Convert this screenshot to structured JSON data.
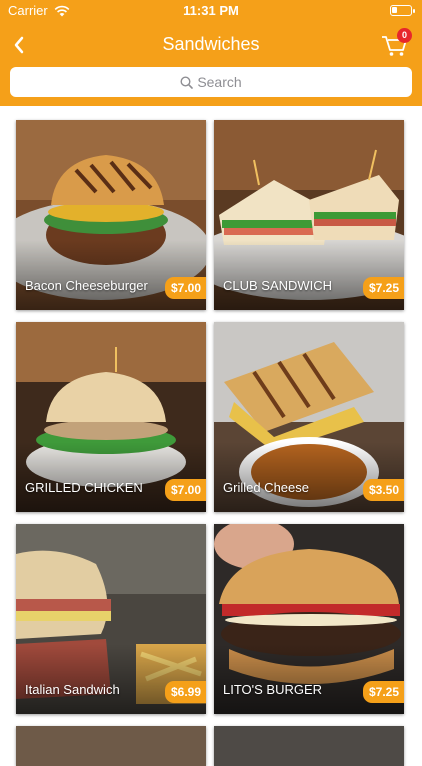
{
  "status_bar": {
    "carrier": "Carrier",
    "time": "11:31 PM"
  },
  "nav": {
    "title": "Sandwiches",
    "cart_count": "0"
  },
  "search": {
    "placeholder": "Search"
  },
  "colors": {
    "accent": "#f5a019",
    "badge": "#e7262b"
  },
  "items": [
    {
      "name": "Bacon Cheeseburger",
      "price": "$7.00"
    },
    {
      "name": "CLUB SANDWICH",
      "price": "$7.25"
    },
    {
      "name": "GRILLED CHICKEN",
      "price": "$7.00"
    },
    {
      "name": "Grilled Cheese",
      "price": "$3.50"
    },
    {
      "name": "Italian Sandwich",
      "price": "$6.99"
    },
    {
      "name": "LITO'S BURGER",
      "price": "$7.25"
    }
  ]
}
